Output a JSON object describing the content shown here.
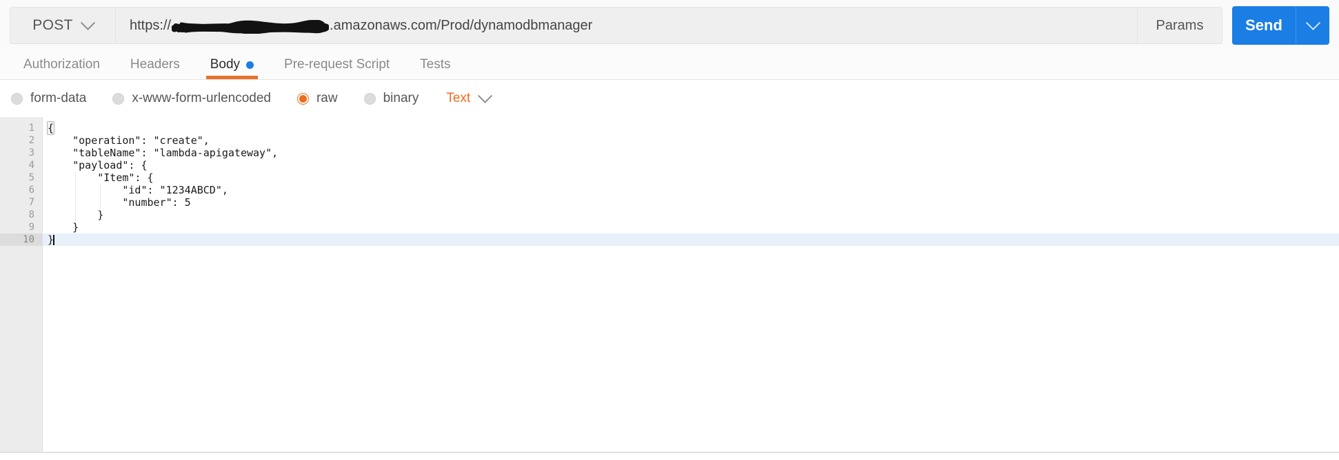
{
  "request_bar": {
    "method": "POST",
    "method_caret_icon": "chevron-down-icon",
    "url_prefix": "https://",
    "url_redacted": "",
    "url_suffix": ".amazonaws.com/Prod/dynamodbmanager",
    "url_full_visible": "https://████████████.amazonaws.com/Prod/dynamodbmanager",
    "params_label": "Params",
    "send_label": "Send",
    "send_caret_icon": "chevron-down-icon",
    "send_color": "#1a7ee5"
  },
  "tabs": [
    {
      "label": "Authorization",
      "active": false,
      "dot": false
    },
    {
      "label": "Headers",
      "active": false,
      "dot": false
    },
    {
      "label": "Body",
      "active": true,
      "dot": true
    },
    {
      "label": "Pre-request Script",
      "active": false,
      "dot": false
    },
    {
      "label": "Tests",
      "active": false,
      "dot": false
    }
  ],
  "tab_accent_color": "#e8722a",
  "tab_dot_color": "#1a7ee5",
  "body_type": {
    "options": [
      {
        "label": "form-data",
        "selected": false
      },
      {
        "label": "x-www-form-urlencoded",
        "selected": false
      },
      {
        "label": "raw",
        "selected": true
      },
      {
        "label": "binary",
        "selected": false
      }
    ],
    "content_type_label": "Text",
    "content_type_caret_icon": "chevron-down-icon",
    "selected_color": "#ef6c1a"
  },
  "editor": {
    "active_line": 10,
    "line_numbers": [
      "1",
      "2",
      "3",
      "4",
      "5",
      "6",
      "7",
      "8",
      "9",
      "10"
    ],
    "lines": [
      "{",
      "    \"operation\": \"create\",",
      "    \"tableName\": \"lambda-apigateway\",",
      "    \"payload\": {",
      "        \"Item\": {",
      "            \"id\": \"1234ABCD\",",
      "            \"number\": 5",
      "        }",
      "    }",
      "}"
    ]
  }
}
